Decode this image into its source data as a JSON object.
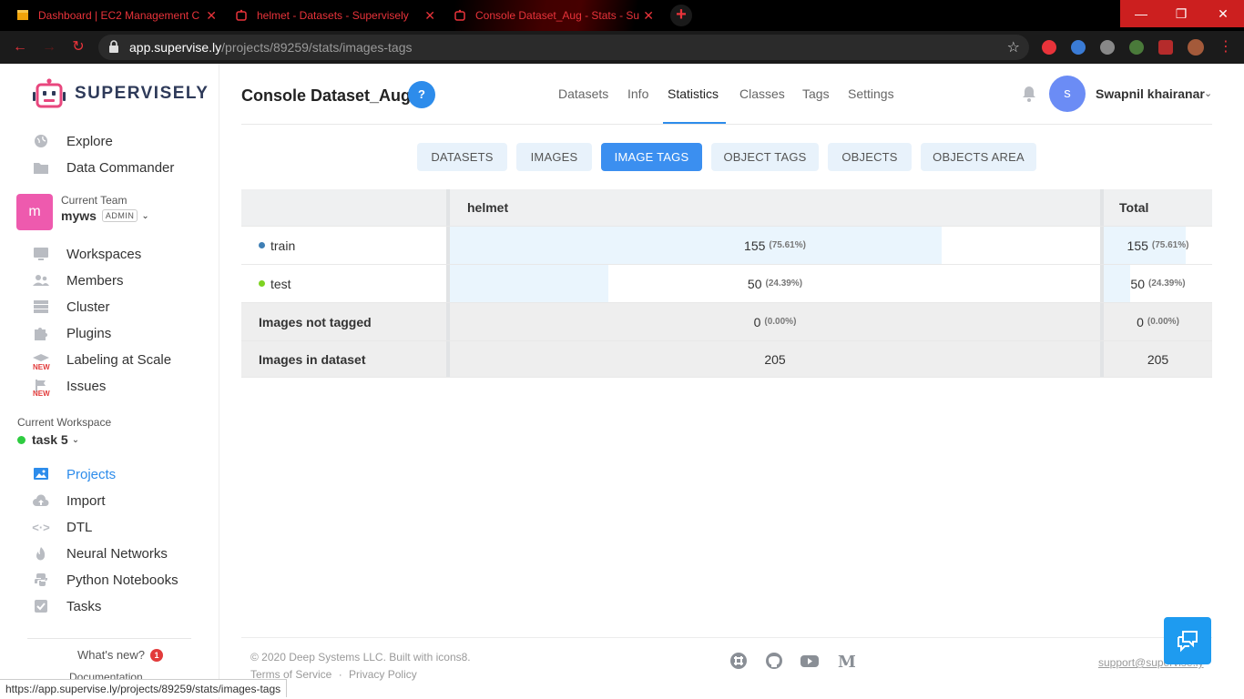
{
  "browser": {
    "tabs": [
      {
        "title": "Dashboard | EC2 Management C",
        "icon": "aws-icon"
      },
      {
        "title": "helmet - Datasets - Supervisely",
        "icon": "supervisely-icon"
      },
      {
        "title": "Console Dataset_Aug - Stats - Su",
        "icon": "supervisely-icon"
      }
    ],
    "url_host": "app.supervise.ly",
    "url_path": "/projects/89259/stats/images-tags",
    "status_url": "https://app.supervise.ly/projects/89259/stats/images-tags",
    "accent": "#e8333a"
  },
  "sidebar": {
    "logo": "SUPERVISELY",
    "top_items": [
      {
        "label": "Explore",
        "icon": "globe-icon"
      },
      {
        "label": "Data Commander",
        "icon": "folder-icon"
      }
    ],
    "team": {
      "label": "Current Team",
      "name": "myws",
      "role": "ADMIN",
      "avatar": "m"
    },
    "team_items": [
      {
        "label": "Workspaces",
        "icon": "monitor-icon"
      },
      {
        "label": "Members",
        "icon": "members-icon"
      },
      {
        "label": "Cluster",
        "icon": "cluster-icon"
      },
      {
        "label": "Plugins",
        "icon": "puzzle-icon"
      },
      {
        "label": "Labeling at Scale",
        "icon": "graduation-cap-icon",
        "badge": "NEW"
      },
      {
        "label": "Issues",
        "icon": "flag-icon",
        "badge": "NEW"
      }
    ],
    "workspace": {
      "label": "Current Workspace",
      "name": "task 5"
    },
    "ws_items": [
      {
        "label": "Projects",
        "icon": "images-icon",
        "active": true
      },
      {
        "label": "Import",
        "icon": "cloud-upload-icon"
      },
      {
        "label": "DTL",
        "icon": "code-icon"
      },
      {
        "label": "Neural Networks",
        "icon": "flame-icon"
      },
      {
        "label": "Python Notebooks",
        "icon": "python-icon"
      },
      {
        "label": "Tasks",
        "icon": "checklist-icon"
      }
    ],
    "whats_new": "What's new?",
    "whats_new_count": "1",
    "documentation": "Documentation"
  },
  "header": {
    "project_title": "Console Dataset_Aug",
    "help": "?",
    "tabs": [
      "Datasets",
      "Info",
      "Statistics",
      "Classes",
      "Tags",
      "Settings"
    ],
    "active_tab": "Statistics",
    "user": {
      "initial": "s",
      "name": "Swapnil khairanar"
    }
  },
  "subtabs": [
    "DATASETS",
    "IMAGES",
    "IMAGE TAGS",
    "OBJECT TAGS",
    "OBJECTS",
    "OBJECTS AREA"
  ],
  "active_subtab": "IMAGE TAGS",
  "table": {
    "columns": [
      "",
      "helmet",
      "Total"
    ],
    "rows": [
      {
        "name": "train",
        "dot_color": "#3f7fb5",
        "helmet": "155",
        "helmet_pct": "(75.61%)",
        "helmet_fill": 0.7561,
        "total": "155",
        "total_pct": "(75.61%)",
        "total_fill": 0.7561
      },
      {
        "name": "test",
        "dot_color": "#7ed321",
        "helmet": "50",
        "helmet_pct": "(24.39%)",
        "helmet_fill": 0.2439,
        "total": "50",
        "total_pct": "(24.39%)",
        "total_fill": 0.2439
      },
      {
        "name": "Images not tagged",
        "helmet": "0",
        "helmet_pct": "(0.00%)",
        "total": "0",
        "total_pct": "(0.00%)"
      },
      {
        "name": "Images in dataset",
        "helmet": "205",
        "total": "205"
      }
    ]
  },
  "footer": {
    "copyright": "© 2020 Deep Systems LLC. Built with icons8.",
    "terms": "Terms of Service",
    "sep": "·",
    "privacy": "Privacy Policy",
    "support": "support@supervise.ly",
    "social": [
      "slack-icon",
      "github-icon",
      "youtube-icon",
      "medium-icon"
    ]
  },
  "colors": {
    "primary": "#2d8ceb",
    "subtab_bg": "#e8f2fb",
    "bar_fill": "#eaf5fd"
  }
}
